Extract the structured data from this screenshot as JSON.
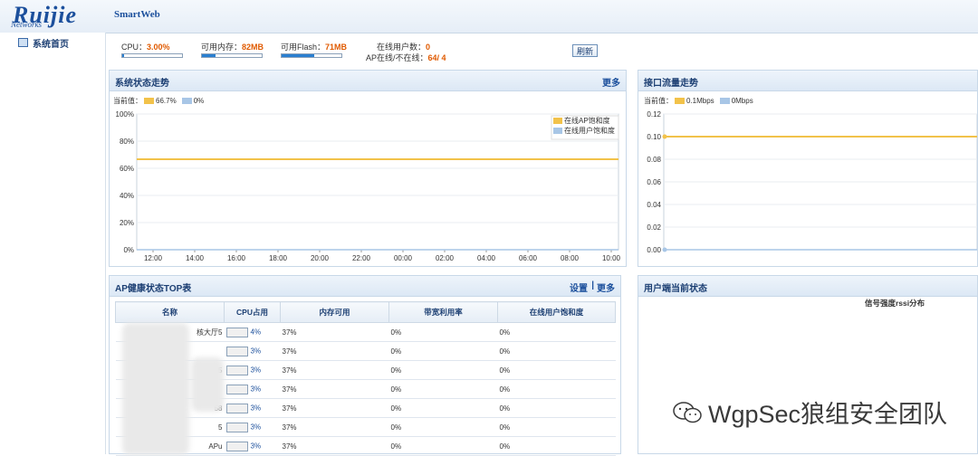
{
  "header": {
    "logo": "Ruijie",
    "logo_sub": "Networks",
    "brand": "SmartWeb"
  },
  "sidebar": {
    "items": [
      {
        "label": "系统首页"
      }
    ]
  },
  "stats": {
    "cpu_label": "CPU：",
    "cpu_value": "3.00%",
    "cpu_fraction": 0.03,
    "mem_label": "可用内存：",
    "mem_value": "82MB",
    "mem_fraction": 0.22,
    "flash_label": "可用Flash：",
    "flash_value": "71MB",
    "flash_fraction": 0.55,
    "users_label": "在线用户数：",
    "users_value": "0",
    "ap_label": "AP在线/不在线：",
    "ap_value": "64/ 4",
    "refresh_label": "刷新"
  },
  "system_panel": {
    "title": "系统状态走势",
    "more": "更多",
    "current_label": "当前值：",
    "current_ap": "66.7%",
    "current_user": "0%",
    "legend": [
      "在线AP饱和度",
      "在线用户饱和度"
    ],
    "colors": {
      "ap": "#f2c24a",
      "user": "#a8c6e6"
    }
  },
  "interface_panel": {
    "title": "接口流量走势",
    "current_label": "当前值：",
    "current_a": "0.1Mbps",
    "current_b": "0Mbps"
  },
  "ap_panel": {
    "title": "AP健康状态TOP表",
    "settings": "设置",
    "sep": "|",
    "more": "更多",
    "columns": [
      "名称",
      "CPU占用",
      "内存可用",
      "带宽利用率",
      "在线用户饱和度"
    ],
    "rows": [
      {
        "name": "核大厅5",
        "cpu": "4%",
        "mem": "37%",
        "bw": "0%",
        "sat": "0%"
      },
      {
        "name": "",
        "cpu": "3%",
        "mem": "37%",
        "bw": "0%",
        "sat": "0%"
      },
      {
        "name": "5",
        "cpu": "3%",
        "mem": "37%",
        "bw": "0%",
        "sat": "0%"
      },
      {
        "name": "",
        "cpu": "3%",
        "mem": "37%",
        "bw": "0%",
        "sat": "0%"
      },
      {
        "name": "58",
        "cpu": "3%",
        "mem": "37%",
        "bw": "0%",
        "sat": "0%"
      },
      {
        "name": "5",
        "cpu": "3%",
        "mem": "37%",
        "bw": "0%",
        "sat": "0%"
      },
      {
        "name": "APu",
        "cpu": "3%",
        "mem": "37%",
        "bw": "0%",
        "sat": "0%"
      }
    ]
  },
  "client_panel": {
    "title": "用户端当前状态",
    "subtitle": "信号强度rssi分布"
  },
  "watermark": "WgpSec狼组安全团队",
  "chart_data": [
    {
      "type": "line",
      "x": [
        "12:00",
        "14:00",
        "16:00",
        "18:00",
        "20:00",
        "22:00",
        "00:00",
        "02:00",
        "04:00",
        "06:00",
        "08:00",
        "10:00"
      ],
      "ylim": [
        0,
        100
      ],
      "yticks": [
        "0%",
        "20%",
        "40%",
        "60%",
        "80%",
        "100%"
      ],
      "series": [
        {
          "name": "在线AP饱和度",
          "values": [
            66.7,
            66.7,
            66.7,
            66.7,
            66.7,
            66.7,
            66.7,
            66.7,
            66.7,
            66.7,
            66.7,
            66.7
          ]
        },
        {
          "name": "在线用户饱和度",
          "values": [
            0,
            0,
            0,
            0,
            0,
            0,
            0,
            0,
            0,
            0,
            0,
            0
          ]
        }
      ],
      "legend": "top-right"
    },
    {
      "type": "line",
      "ylim": [
        0,
        0.12
      ],
      "yticks": [
        "0.00",
        "0.02",
        "0.04",
        "0.06",
        "0.08",
        "0.10",
        "0.12"
      ],
      "series": [
        {
          "name": "0.1Mbps",
          "values": [
            0.1,
            0.1
          ]
        },
        {
          "name": "0Mbps",
          "values": [
            0,
            0
          ]
        }
      ]
    }
  ]
}
